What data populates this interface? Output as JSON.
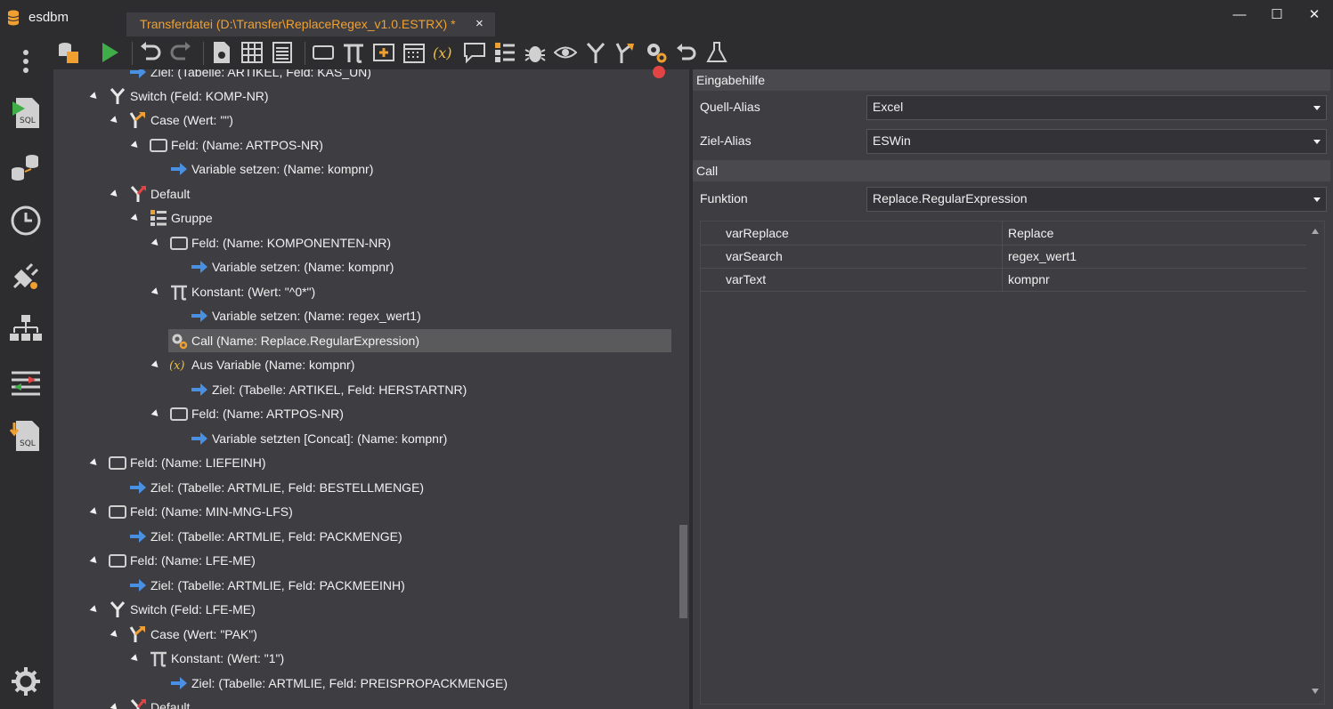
{
  "app": {
    "name": "esdbm"
  },
  "tab": {
    "title": "Transferdatei (D:\\Transfer\\ReplaceRegex_v1.0.ESTRX) *",
    "close": "×"
  },
  "window": {
    "minimize": "—",
    "maximize": "☐",
    "close": "✕"
  },
  "tree": [
    {
      "label": "Ziel: (Tabelle: ARTIKEL, Feld: KAS_UN)",
      "icon": "arrow-right-icon"
    },
    {
      "label": "Switch (Feld: KOMP-NR)",
      "icon": "switch-icon"
    },
    {
      "label": "Case (Wert: \"\")",
      "icon": "case-icon"
    },
    {
      "label": "Feld: (Name: ARTPOS-NR)",
      "icon": "field-icon"
    },
    {
      "label": "Variable setzen: (Name: kompnr)",
      "icon": "arrow-right-icon"
    },
    {
      "label": "Default",
      "icon": "default-icon"
    },
    {
      "label": "Gruppe",
      "icon": "group-icon"
    },
    {
      "label": "Feld: (Name: KOMPONENTEN-NR)",
      "icon": "field-icon"
    },
    {
      "label": "Variable setzen: (Name: kompnr)",
      "icon": "arrow-right-icon"
    },
    {
      "label": "Konstant: (Wert: \"^0*\")",
      "icon": "pi-icon"
    },
    {
      "label": "Variable setzen: (Name: regex_wert1)",
      "icon": "arrow-right-icon"
    },
    {
      "label": "Call (Name: Replace.RegularExpression)",
      "icon": "gears-icon"
    },
    {
      "label": "Aus Variable (Name: kompnr)",
      "icon": "variable-icon"
    },
    {
      "label": "Ziel: (Tabelle: ARTIKEL, Feld: HERSTARTNR)",
      "icon": "arrow-right-icon"
    },
    {
      "label": "Feld: (Name: ARTPOS-NR)",
      "icon": "field-icon"
    },
    {
      "label": "Variable setzten [Concat]: (Name: kompnr)",
      "icon": "arrow-right-icon"
    },
    {
      "label": "Feld: (Name: LIEFEINH)",
      "icon": "field-icon"
    },
    {
      "label": "Ziel: (Tabelle: ARTMLIE, Feld: BESTELLMENGE)",
      "icon": "arrow-right-icon"
    },
    {
      "label": "Feld: (Name: MIN-MNG-LFS)",
      "icon": "field-icon"
    },
    {
      "label": "Ziel: (Tabelle: ARTMLIE, Feld: PACKMENGE)",
      "icon": "arrow-right-icon"
    },
    {
      "label": "Feld: (Name: LFE-ME)",
      "icon": "field-icon"
    },
    {
      "label": "Ziel: (Tabelle: ARTMLIE, Feld: PACKMEEINH)",
      "icon": "arrow-right-icon"
    },
    {
      "label": "Switch (Feld: LFE-ME)",
      "icon": "switch-icon"
    },
    {
      "label": "Case (Wert: \"PAK\")",
      "icon": "case-icon"
    },
    {
      "label": "Konstant: (Wert: \"1\")",
      "icon": "pi-icon"
    },
    {
      "label": "Ziel: (Tabelle: ARTMLIE, Feld: PREISPROPACKMENGE)",
      "icon": "arrow-right-icon"
    },
    {
      "label": "Default",
      "icon": "default-icon"
    }
  ],
  "props": {
    "section1": "Eingabehilfe",
    "quell_label": "Quell-Alias",
    "quell_value": "Excel",
    "ziel_label": "Ziel-Alias",
    "ziel_value": "ESWin",
    "section2": "Call",
    "funktion_label": "Funktion",
    "funktion_value": "Replace.RegularExpression",
    "params": [
      {
        "key": "varReplace",
        "value": "Replace"
      },
      {
        "key": "varSearch",
        "value": "regex_wert1"
      },
      {
        "key": "varText",
        "value": "kompnr"
      }
    ]
  },
  "colors": {
    "accent": "#f0a030",
    "arrow": "#4a90e2",
    "switch": "#f1f1f1",
    "case": "#f0a030",
    "default": "#e04444"
  }
}
